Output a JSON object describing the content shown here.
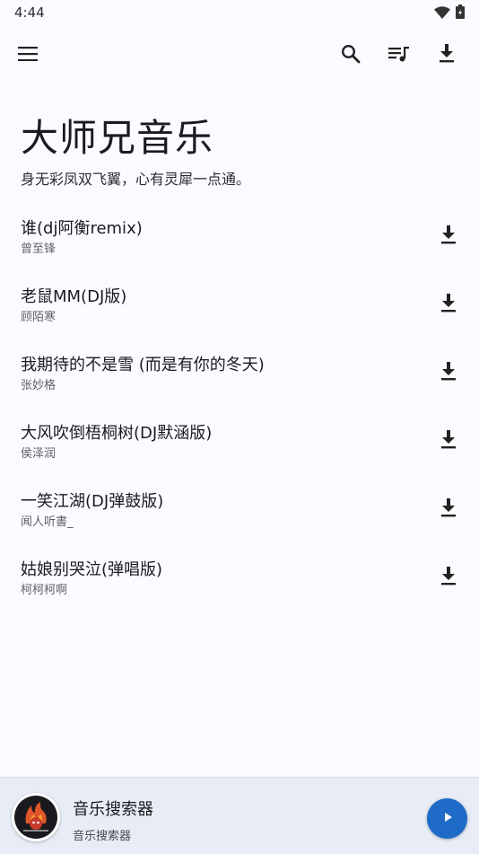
{
  "status_bar": {
    "time": "4:44",
    "icons": [
      "wifi-icon",
      "battery-icon"
    ]
  },
  "toolbar": {
    "icons": [
      "menu-icon",
      "search-icon",
      "queue-music-icon",
      "download-icon"
    ]
  },
  "header": {
    "title": "大师兄音乐",
    "subtitle": "身无彩凤双飞翼，心有灵犀一点通。"
  },
  "songs": [
    {
      "title": "谁(dj阿衡remix)",
      "artist": "曾至锋"
    },
    {
      "title": "老鼠MM(DJ版)",
      "artist": "顾陌寒"
    },
    {
      "title": "我期待的不是雪 (而是有你的冬天)",
      "artist": "张妙格"
    },
    {
      "title": "大风吹倒梧桐树(DJ默涵版)",
      "artist": "侯泽润"
    },
    {
      "title": "一笑江湖(DJ弹鼓版)",
      "artist": "闻人听書_"
    },
    {
      "title": "姑娘别哭泣(弹唱版)",
      "artist": "柯柯柯啊"
    }
  ],
  "player": {
    "title": "音乐搜索器",
    "subtitle": "音乐搜索器"
  },
  "colors": {
    "background": "#FCFAFF",
    "player_bar": "#E7ECF6",
    "accent": "#1E6CC8",
    "text": "#1B1B1F"
  }
}
